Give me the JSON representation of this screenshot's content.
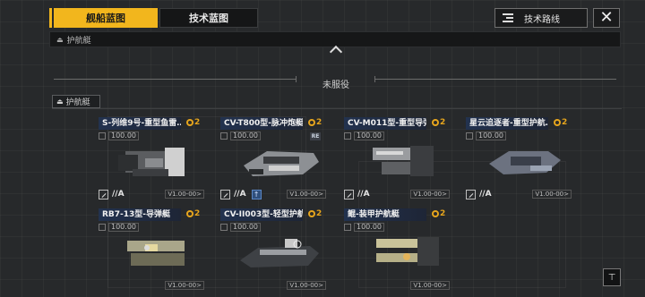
{
  "tabs": [
    {
      "label": "舰船蓝图",
      "active": true
    },
    {
      "label": "技术蓝图",
      "active": false
    }
  ],
  "tech_route_label": "技术路线",
  "close_label": "✕",
  "filter_bar_label": "护航艇",
  "section_title": "未服役",
  "category_label": "护航艇",
  "cards": [
    {
      "title": "S-列维9号-重型鱼雷…",
      "stars": "2",
      "level": "100.00",
      "grade": "//A",
      "version": "V1.00-00>",
      "badge": "",
      "upgrade": false
    },
    {
      "title": "CV-T800型-脉冲炮艇",
      "stars": "2",
      "level": "100.00",
      "grade": "//A",
      "version": "V1.00-00>",
      "badge": "RE",
      "upgrade": true
    },
    {
      "title": "CV-M011型-重型导弹…",
      "stars": "2",
      "level": "100.00",
      "grade": "//A",
      "version": "V1.00-00>",
      "badge": "",
      "upgrade": false
    },
    {
      "title": "星云追逐者-重型护航…",
      "stars": "2",
      "level": "100.00",
      "grade": "//A",
      "version": "V1.00-00>",
      "badge": "",
      "upgrade": false
    },
    {
      "title": "RB7-13型-导弹艇",
      "stars": "2",
      "level": "100.00",
      "grade": "",
      "version": "V1.00-00>",
      "badge": "",
      "upgrade": false
    },
    {
      "title": "CV-II003型-轻型护航…",
      "stars": "2",
      "level": "100.00",
      "grade": "",
      "version": "V1.00-00>",
      "badge": "",
      "upgrade": false
    },
    {
      "title": "鲲-装甲护航艇",
      "stars": "2",
      "level": "100.00",
      "grade": "",
      "version": "V1.00-00>",
      "badge": "",
      "upgrade": false
    }
  ],
  "colors": {
    "accent": "#f2b61d",
    "star": "#e6a51d",
    "title_bg": "#22324f"
  },
  "icons": [
    "filter-list-icon",
    "close-icon",
    "chevron-up-icon",
    "ship-icon",
    "ammo-icon",
    "upgrade-icon",
    "sort-filter-icon"
  ]
}
